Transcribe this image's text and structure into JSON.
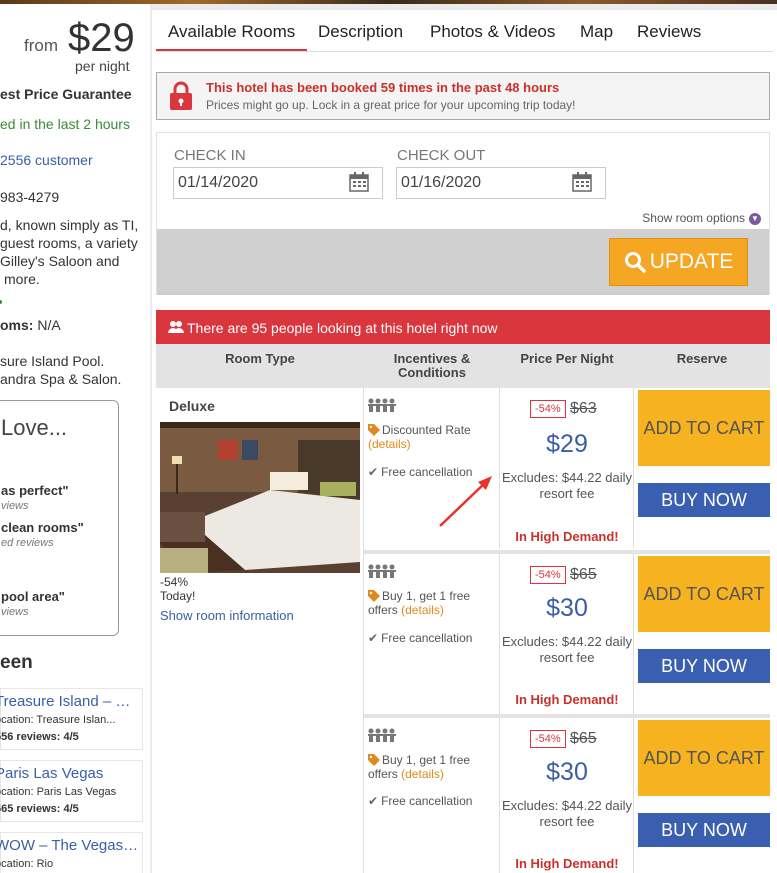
{
  "sidebar": {
    "from_label": "from",
    "price": "$29",
    "per_night": "per night",
    "guarantee": "est Price Guarantee",
    "booked_recent": "ed in the last 2 hours",
    "customer": "2556 customer",
    "phone": "983-4279",
    "desc_lines": [
      "d, known simply as TI,",
      "guest rooms, a variety",
      "Gilley's Saloon and",
      "more."
    ],
    "rooms_label": "oms:",
    "rooms_value": "N/A",
    "amenity_lines": [
      "sure Island Pool.",
      "andra Spa & Salon."
    ],
    "love": {
      "title": "Love...",
      "items": [
        {
          "quote": "as perfect\"",
          "sub": "views"
        },
        {
          "quote": "clean rooms\"",
          "sub": "ed reviews"
        },
        {
          "quote": "pool area\"",
          "sub": "views"
        }
      ]
    },
    "seen_title": "een",
    "seen_hotels": [
      {
        "name": "Treasure Island – …",
        "location": "ocation: Treasure Islan...",
        "reviews": "556 reviews: 4/5"
      },
      {
        "name": "Paris Las Vegas",
        "location": "ocation: Paris Las Vegas",
        "reviews": "665 reviews: 4/5"
      },
      {
        "name": "WOW – The Vegas…",
        "location": "ocation: Rio",
        "reviews": ""
      }
    ]
  },
  "tabs": [
    "Available Rooms",
    "Description",
    "Photos & Videos",
    "Map",
    "Reviews"
  ],
  "alert": {
    "title": "This hotel has been booked 59 times in the past 48 hours",
    "subtitle": "Prices might go up. Lock in a great price for your upcoming trip today!"
  },
  "dates": {
    "checkin_label": "CHECK IN",
    "checkin_value": "01/14/2020",
    "checkout_label": "CHECK OUT",
    "checkout_value": "01/16/2020",
    "room_options": "Show room options",
    "update_label": "UPDATE"
  },
  "people_notice": "There are 95 people looking at this hotel right now",
  "table": {
    "headers": [
      "Room Type",
      "Incentives & Conditions",
      "Price Per Night",
      "Reserve"
    ],
    "room_type": {
      "name": "Deluxe",
      "discount": "-54%",
      "today": "Today!",
      "info_link": "Show room information"
    },
    "offers": [
      {
        "incentive": "Discounted Rate",
        "details": "(details)",
        "cancel": "Free cancellation",
        "discount": "-54%",
        "old_price": "$63",
        "new_price": "$29",
        "excludes": "Excludes: $44.22 daily resort fee",
        "demand": "In High Demand!",
        "cart": "ADD TO CART",
        "buy": "BUY NOW"
      },
      {
        "incentive": "Buy 1, get 1 free offers",
        "details": "(details)",
        "cancel": "Free cancellation",
        "discount": "-54%",
        "old_price": "$65",
        "new_price": "$30",
        "excludes": "Excludes: $44.22 daily resort fee",
        "demand": "In High Demand!",
        "cart": "ADD TO CART",
        "buy": "BUY NOW"
      },
      {
        "incentive": "Buy 1, get 1 free offers",
        "details": "(details)",
        "cancel": "Free cancellation",
        "discount": "-54%",
        "old_price": "$65",
        "new_price": "$30",
        "excludes": "Excludes: $44.22 daily resort fee",
        "demand": "In High Demand!",
        "cart": "ADD TO CART",
        "buy": "BUY NOW"
      }
    ]
  },
  "colors": {
    "accent_red": "#d9363e",
    "link_blue": "#3a5ea8",
    "cart_yellow": "#f6b21f",
    "update_orange": "#f5a623",
    "buy_blue": "#3a5eb0"
  }
}
